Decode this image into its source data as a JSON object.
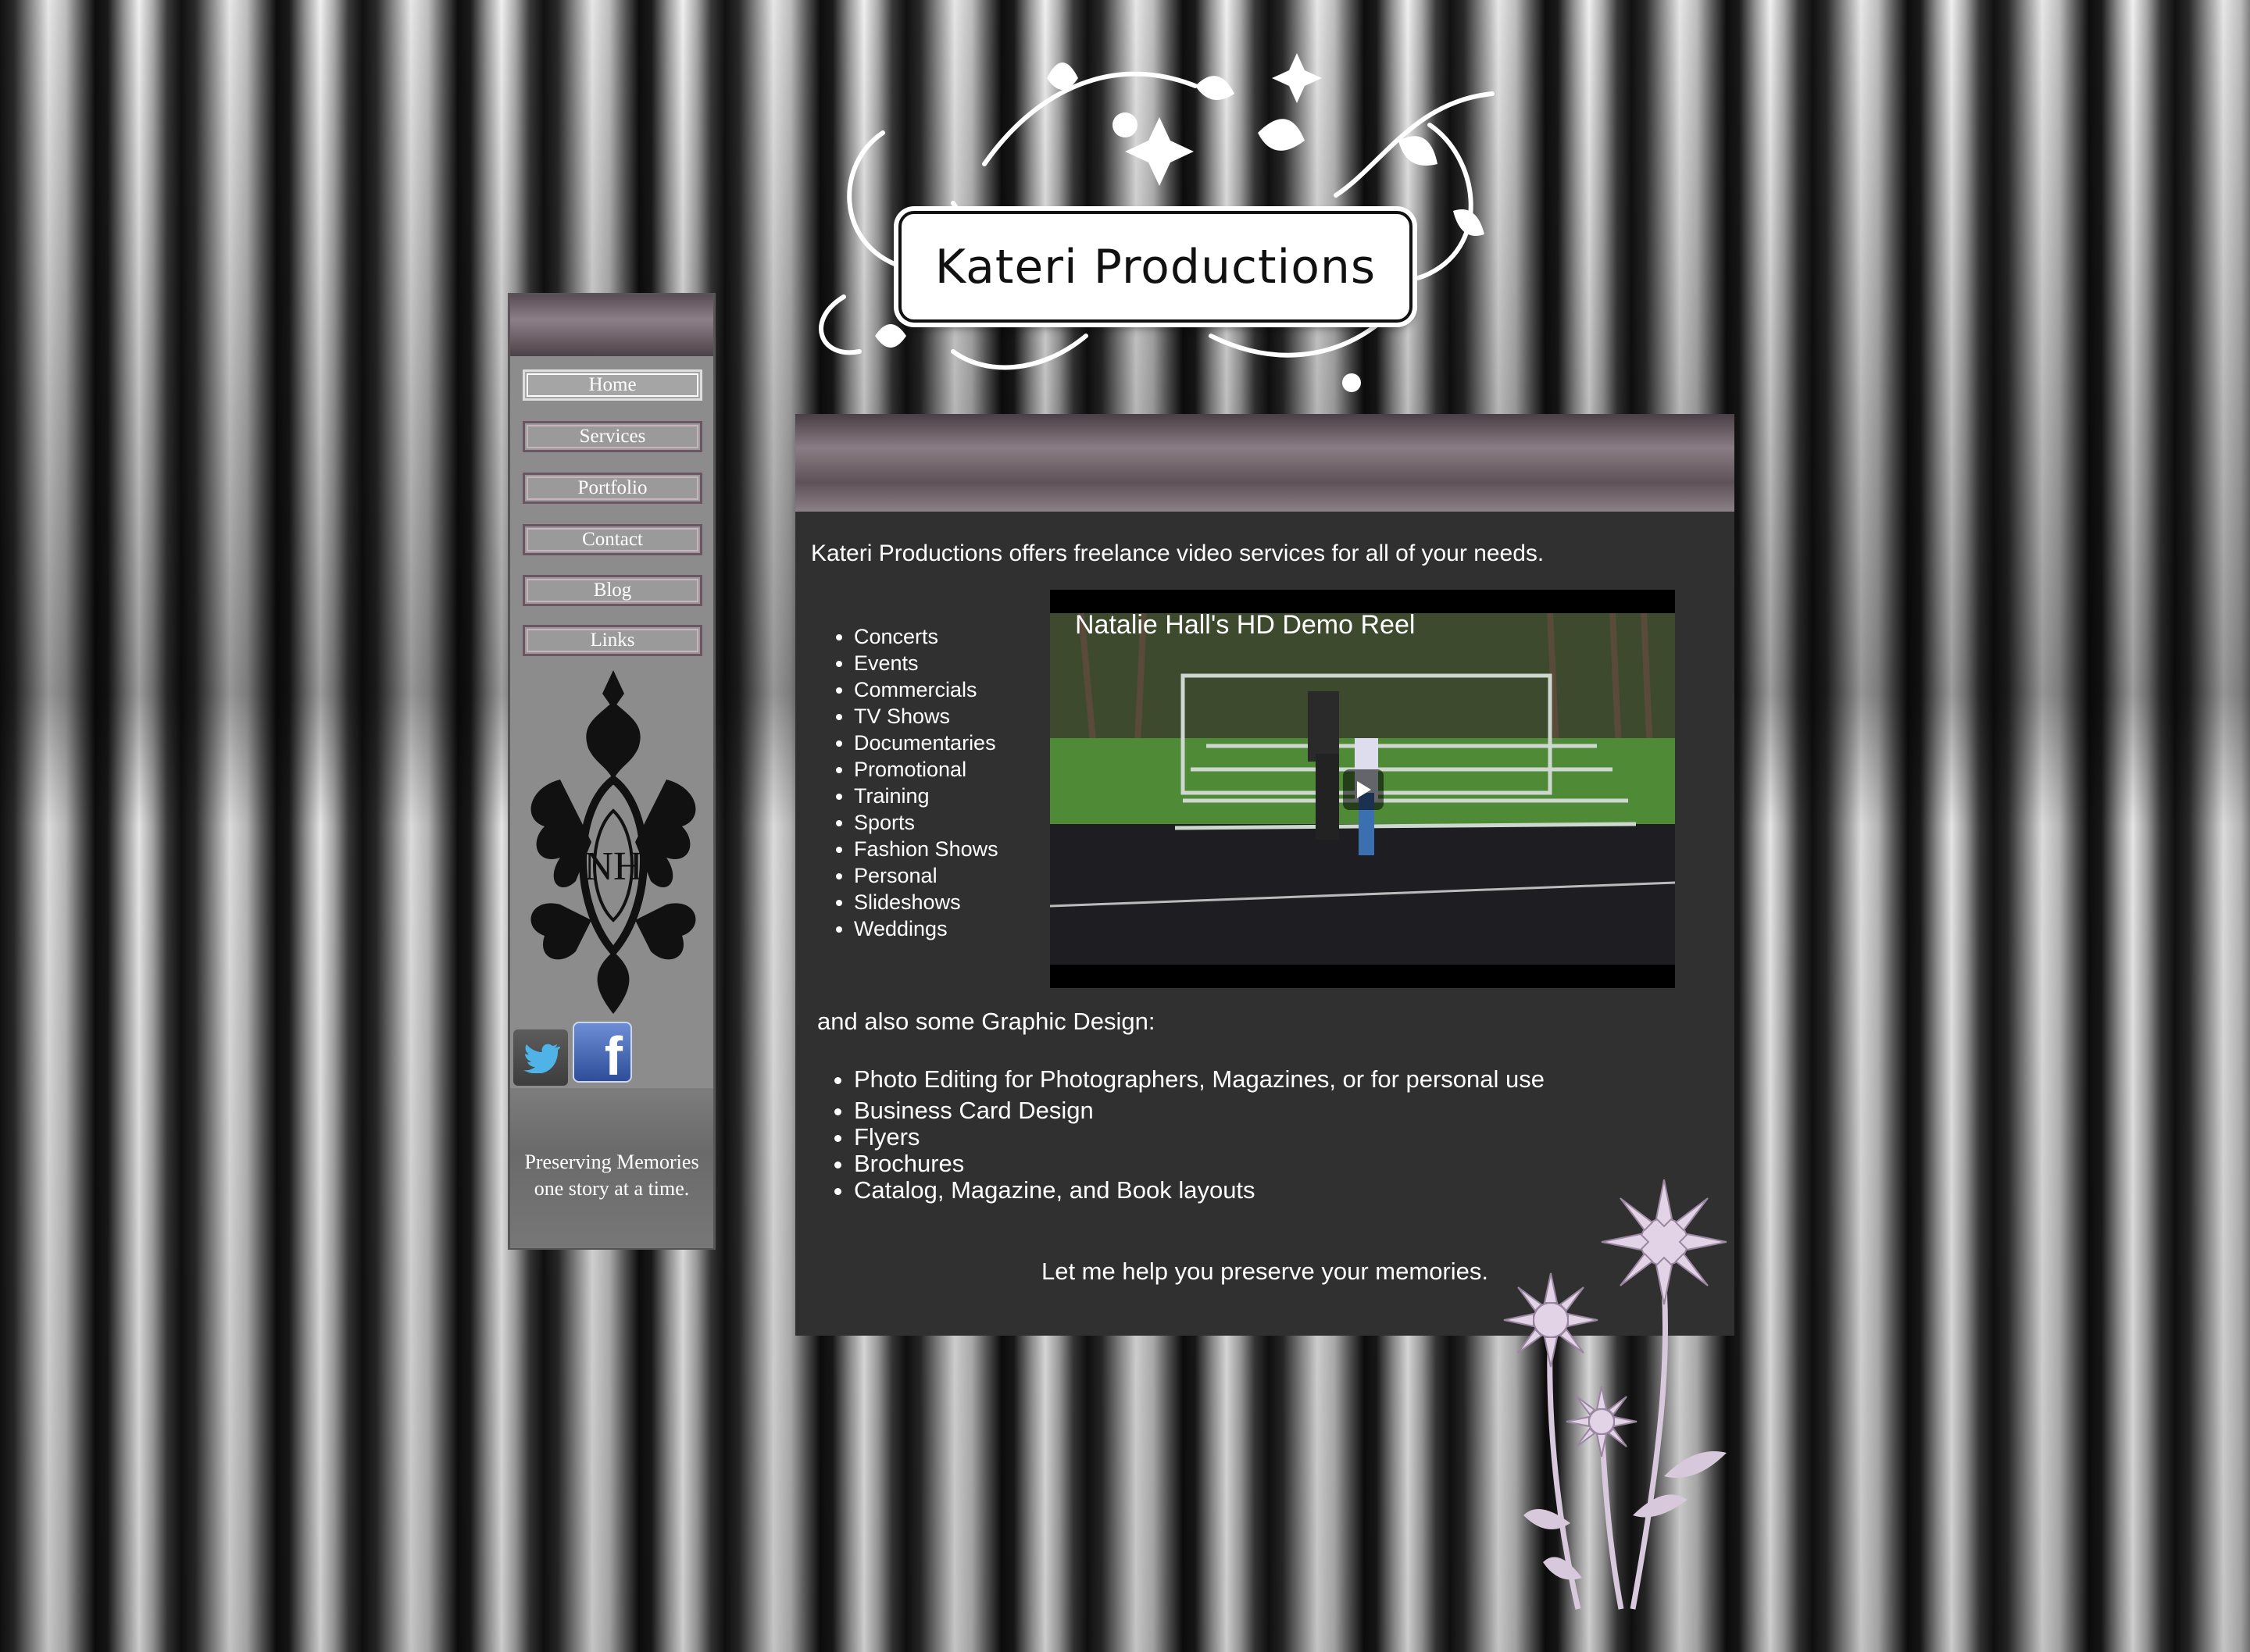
{
  "header": {
    "logo_title": "Kateri Productions"
  },
  "sidebar": {
    "nav": [
      "Home",
      "Services",
      "Portfolio",
      "Contact",
      "Blog",
      "Links"
    ],
    "active": "Home",
    "monogram": "NH",
    "social": {
      "twitter_icon": "twitter-bird-icon",
      "facebook_icon": "facebook-f-icon",
      "facebook_letter": "f"
    },
    "tagline_line1": "Preserving Memories",
    "tagline_line2": "one story at a time."
  },
  "main": {
    "intro": "Kateri Productions offers freelance video services for all of your needs.",
    "services": [
      "Concerts",
      "Events",
      "Commercials",
      "TV Shows",
      "Documentaries",
      "Promotional",
      "Training",
      "Sports",
      "Fashion Shows",
      "Personal",
      "Slideshows",
      "Weddings"
    ],
    "video": {
      "title": "Natalie Hall's HD Demo Reel",
      "play_icon": "play-icon"
    },
    "also": "and also some Graphic Design:",
    "design": [
      "Photo Editing for Photographers, Magazines, or for personal use",
      "Business Card Design",
      "Flyers",
      "Brochures",
      "Catalog, Magazine, and Book layouts"
    ],
    "closing": "Let me help you preserve your memories."
  },
  "colors": {
    "panel": "#303030",
    "sidebar": "#8c8c8c",
    "accent": "#6b5560",
    "flower": "#d8c8dc"
  }
}
